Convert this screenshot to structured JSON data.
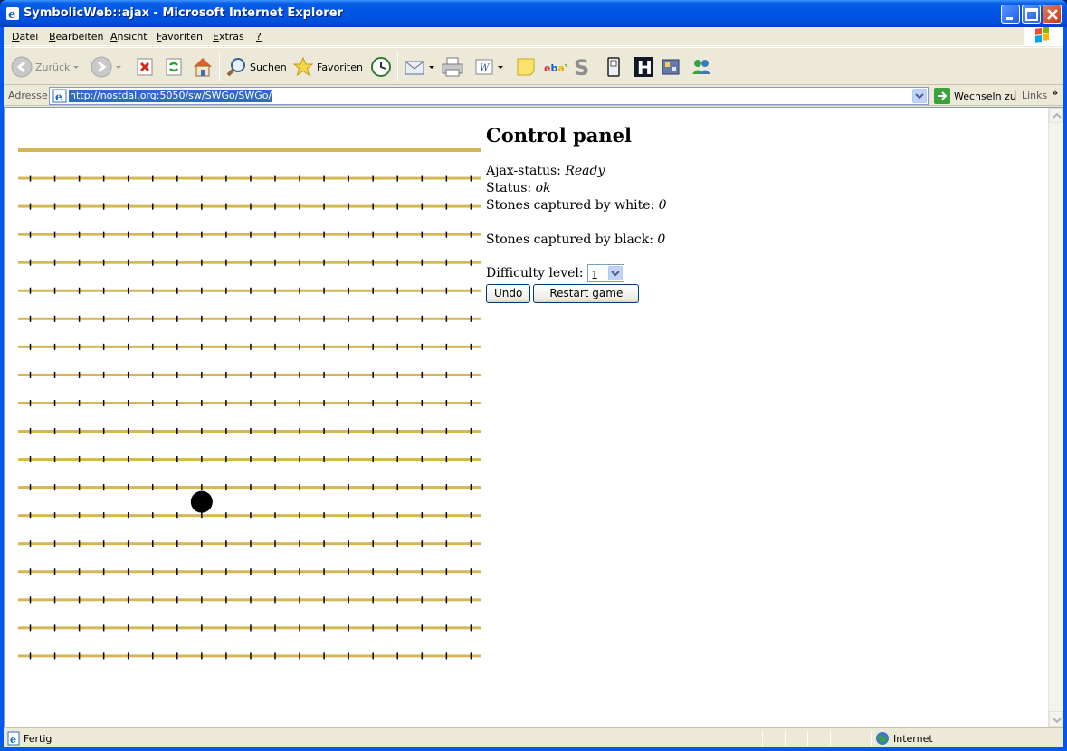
{
  "window": {
    "title": "SymbolicWeb::ajax - Microsoft Internet Explorer"
  },
  "menu": {
    "items": [
      {
        "first": "D",
        "rest": "atei"
      },
      {
        "first": "B",
        "rest": "earbeiten"
      },
      {
        "first": "A",
        "rest": "nsicht"
      },
      {
        "first": "F",
        "rest": "avoriten"
      },
      {
        "first": "E",
        "rest": "xtras"
      },
      {
        "first": "?",
        "rest": ""
      }
    ]
  },
  "toolbar": {
    "back_label": "Zurück",
    "search_label": "Suchen",
    "favorites_label": "Favoriten"
  },
  "address": {
    "label": "Adresse",
    "url": "http://nostdal.org:5050/sw/SWGo/SWGo/",
    "go_label": "Wechseln zu",
    "links_label": "Links",
    "links_chevron": "»"
  },
  "board": {
    "line_color": "#d4b855",
    "tick_color": "#000000",
    "rows": 19,
    "columns": 19,
    "stones": [
      {
        "color": "black",
        "row": 13,
        "col": 7
      }
    ]
  },
  "panel": {
    "title": "Control panel",
    "ajax_status_label": "Ajax-status:",
    "ajax_status_value": "Ready",
    "status_label": "Status:",
    "status_value": "ok",
    "captured_white_label": "Stones captured by white:",
    "captured_white_value": "0",
    "captured_black_label": "Stones captured by black:",
    "captured_black_value": "0",
    "difficulty_label": "Difficulty level:",
    "difficulty_value": "1",
    "undo_label": "Undo",
    "restart_label": "Restart game"
  },
  "statusbar": {
    "text": "Fertig",
    "zone": "Internet"
  }
}
